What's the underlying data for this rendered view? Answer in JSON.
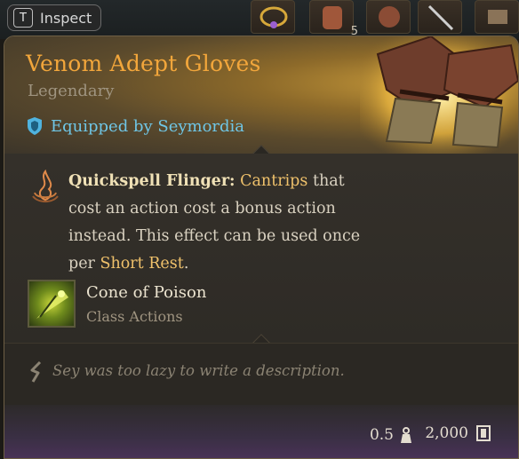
{
  "inspect": {
    "key": "T",
    "label": "Inspect"
  },
  "hotbar": {
    "stack_count": "5"
  },
  "item": {
    "name": "Venom Adept Gloves",
    "rarity": "Legendary",
    "equipped_by": "Equipped by Seymordia"
  },
  "passive": {
    "name": "Quickspell Flinger:",
    "segments": [
      {
        "text": " ",
        "highlight": false
      },
      {
        "text": "Cantrips",
        "highlight": true
      },
      {
        "text": " that cost an action cost a bonus action instead. This effect can be used once per ",
        "highlight": false
      },
      {
        "text": "Short Rest",
        "highlight": true
      },
      {
        "text": ".",
        "highlight": false
      }
    ]
  },
  "spell": {
    "name": "Cone of Poison",
    "category": "Class Actions"
  },
  "description": "Sey was too lazy to write a description.",
  "footer": {
    "weight": "0.5",
    "price": "2,000"
  },
  "colors": {
    "title": "#f2a63b",
    "equipped": "#6fc6e6",
    "highlight": "#efc16b",
    "rarity": "#9f9480"
  },
  "icons": {
    "passive": "flame-hand-icon",
    "spell": "poison-cone-icon",
    "equipped": "shield-icon",
    "description": "feather-icon",
    "weight": "weight-icon",
    "price": "gold-coin-icon"
  }
}
